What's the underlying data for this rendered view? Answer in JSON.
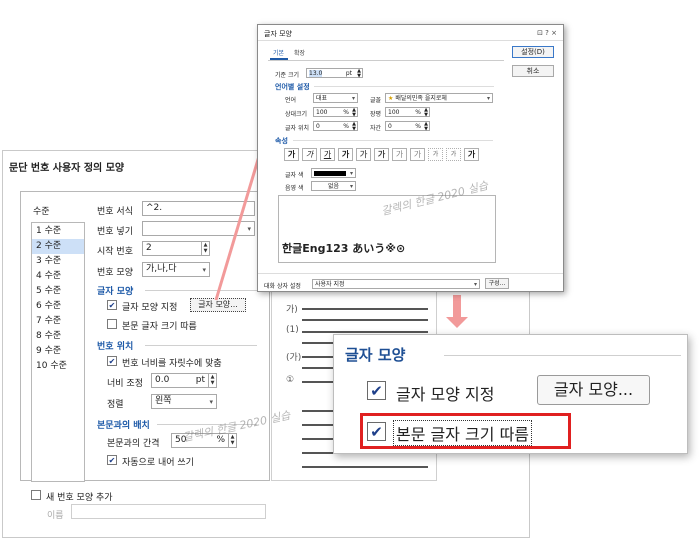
{
  "main_dialog": {
    "title": "문단 번호 사용자 정의 모양",
    "level_header": "수준",
    "levels": [
      "1 수준",
      "2 수준",
      "3 수준",
      "4 수준",
      "5 수준",
      "6 수준",
      "7 수준",
      "8 수준",
      "9 수준",
      "10 수준"
    ],
    "selected_level": "2 수준",
    "number_format_label": "번호 서식",
    "number_format_value": "^2.",
    "number_insert_label": "번호 넣기",
    "start_number_label": "시작 번호",
    "start_number_value": "2",
    "number_shape_label": "번호 모양",
    "number_shape_value": "가,나,다",
    "char_shape_section": "글자 모양",
    "char_shape_specify_label": "글자 모양 지정",
    "char_shape_button": "글자 모양...",
    "follow_body_size_label": "본문 글자 크기 따름",
    "number_position_section": "번호 위치",
    "fit_width_label": "번호 너비를 자릿수에 맞춤",
    "width_adjust_label": "너비 조정",
    "width_adjust_value": "0.0",
    "width_unit": "pt",
    "align_label": "정렬",
    "align_value": "왼쪽",
    "body_arrange_section": "본문과의 배치",
    "body_gap_label": "본문과의 간격",
    "body_gap_value": "50",
    "body_gap_unit": "%",
    "auto_indent_label": "자동으로 내어 쓰기",
    "new_shape_label": "새 번호 모양 추가",
    "name_label": "이름",
    "preview_labels": [
      "가)",
      "(1)",
      "(가)",
      "①"
    ]
  },
  "front_dialog": {
    "title": "글자 모양",
    "window_controls": "⊡ ? ×",
    "tabs": [
      "기본",
      "확장"
    ],
    "active_tab": "기본",
    "ok_button": "설정(D)",
    "cancel_button": "취소",
    "base_size_label": "기준 크기",
    "base_size_value": "13.0",
    "base_size_unit": "pt",
    "lang_section": "언어별 설정",
    "lang_label": "언어",
    "lang_value": "대표",
    "font_label": "글꼴",
    "font_value": "배달의민족 을지로체",
    "rel_size_label": "상대크기",
    "rel_size_value": "100",
    "pct": "%",
    "ratio_label": "장평",
    "ratio_value": "100",
    "pos_label": "글자 위치",
    "pos_value": "0",
    "spacing_label": "자간",
    "spacing_value": "0",
    "attr_section": "속성",
    "attr_buttons": [
      "가",
      "가",
      "가",
      "가",
      "가",
      "가",
      "가",
      "가",
      "가",
      "가",
      "가"
    ],
    "text_color_label": "글자 색",
    "shade_color_label": "음영 색",
    "shade_color_value": "없음",
    "preview_text": "한글Eng123 あいう※⊙",
    "dialog_setting_label": "대화 상자 설정",
    "dialog_setting_value": "사용자 지정",
    "compose_button": "구성..."
  },
  "zoom": {
    "section_title": "글자 모양",
    "specify_label": "글자 모양 지정",
    "shape_button": "글자 모양...",
    "follow_label": "본문 글자 크기 따름"
  },
  "watermark_text": "갈렉의 한글 2020 실습",
  "colors": {
    "accent_blue": "#1e5aa8",
    "highlight_red": "#e02020",
    "arrow_pink": "#f29a9a",
    "selection": "#cde0f7"
  }
}
